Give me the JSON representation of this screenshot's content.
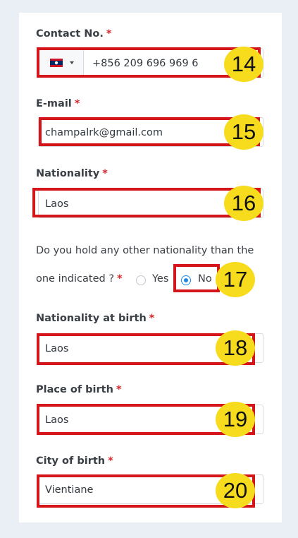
{
  "contact": {
    "label": "Contact No.",
    "required_mark": "*",
    "country_flag": "laos-flag-icon",
    "value": "+856 209 696 969 6",
    "badge": "14"
  },
  "email": {
    "label": "E-mail",
    "required_mark": "*",
    "value": "champalrk@gmail.com",
    "badge": "15"
  },
  "nationality": {
    "label": "Nationality",
    "required_mark": "*",
    "value": "Laos",
    "badge": "16"
  },
  "other_nationality": {
    "question_line1": "Do you hold any other nationality than the",
    "question_line2": "one indicated ?",
    "required_mark": "*",
    "option_yes": "Yes",
    "option_no": "No",
    "selected": "No",
    "badge": "17"
  },
  "nationality_at_birth": {
    "label": "Nationality at birth",
    "required_mark": "*",
    "value": "Laos",
    "badge": "18"
  },
  "place_of_birth": {
    "label": "Place of birth",
    "required_mark": "*",
    "value": "Laos",
    "badge": "19"
  },
  "city_of_birth": {
    "label": "City of birth",
    "required_mark": "*",
    "value": "Vientiane",
    "badge": "20"
  },
  "colors": {
    "highlight": "#d4161b",
    "badge": "#f7dc1d",
    "required": "#d4262b",
    "radio_selected": "#1e88e5"
  }
}
